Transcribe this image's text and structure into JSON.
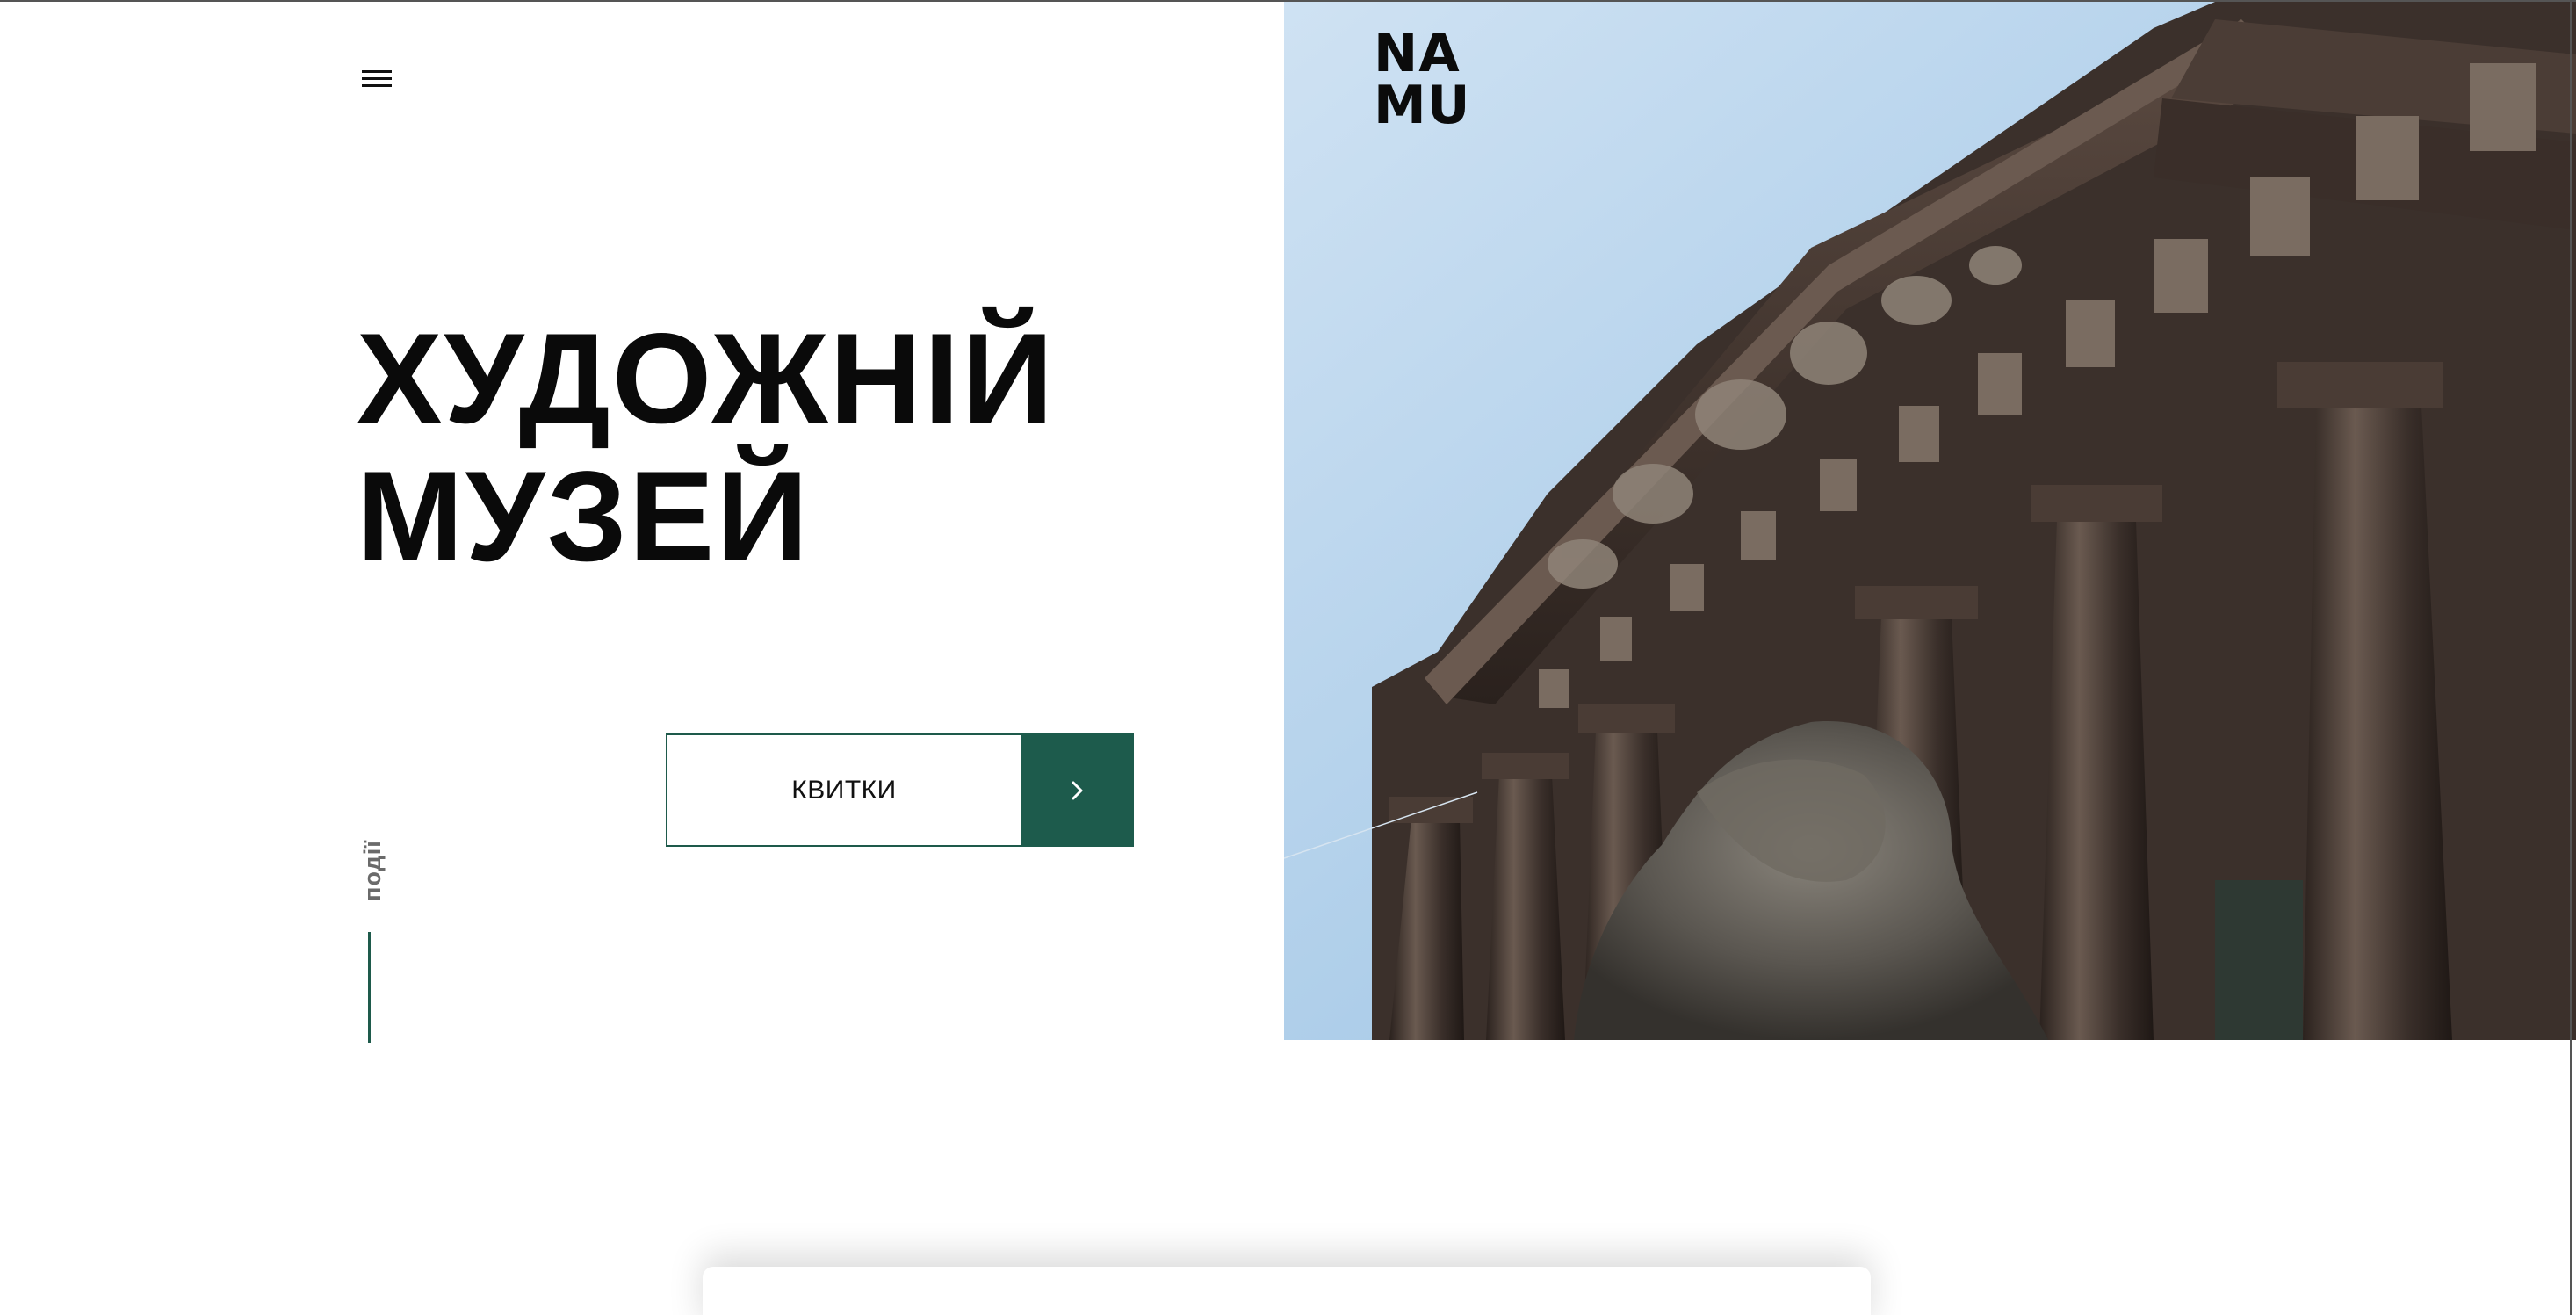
{
  "header": {
    "menu_icon": "hamburger-icon",
    "logo": {
      "line1": "NA",
      "line2": "MU"
    }
  },
  "hero": {
    "title_line1": "ХУДОЖНІЙ",
    "title_line2": "МУЗЕЙ",
    "tickets": {
      "label": "КВИТКИ",
      "icon": "chevron-right-icon"
    },
    "events_link": "події"
  },
  "colors": {
    "accent": "#1d5b4c",
    "text": "#0a0a0a",
    "muted": "#6a6a6a",
    "sky": "#bcd6ee"
  }
}
